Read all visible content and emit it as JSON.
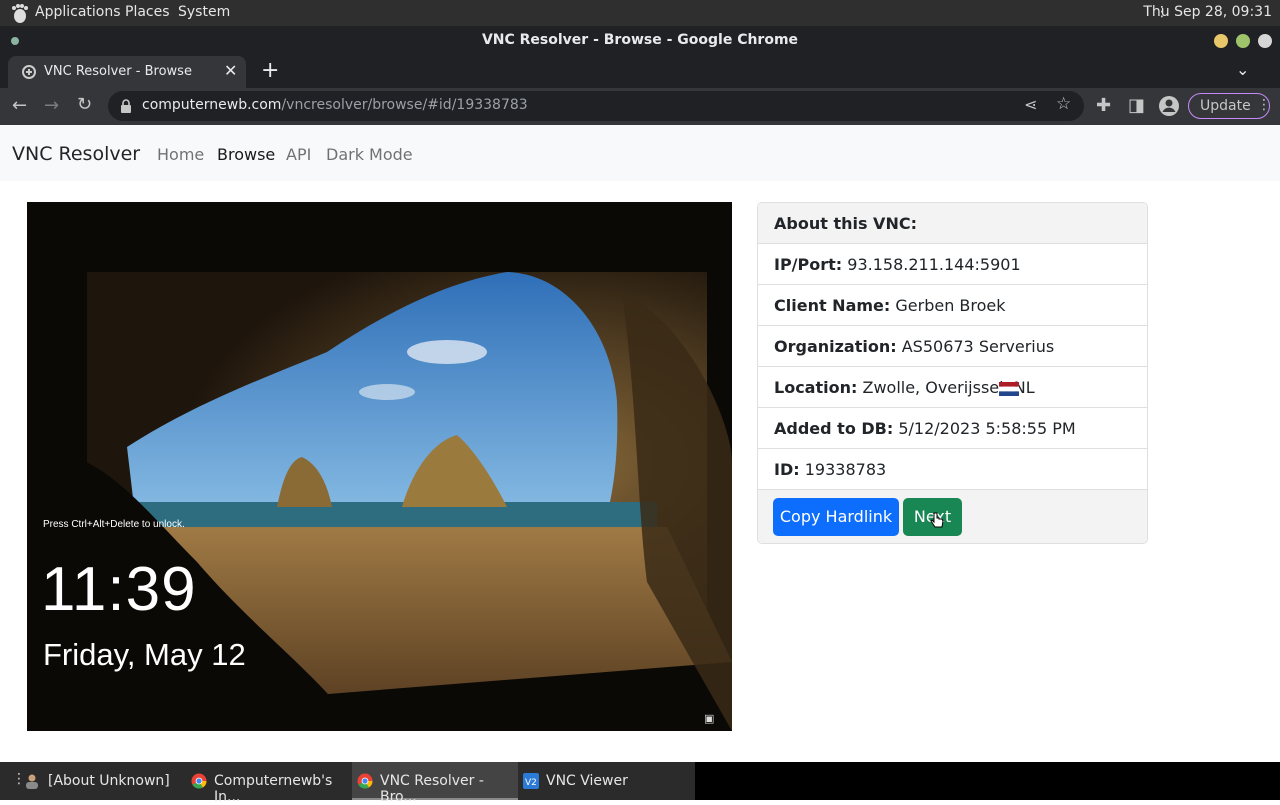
{
  "gnome_panel": {
    "menus": [
      "Applications",
      "Places",
      "System"
    ],
    "clock": "Thu Sep 28, 09:31"
  },
  "window": {
    "title": "VNC Resolver - Browse - Google Chrome"
  },
  "tab": {
    "title": "VNC Resolver - Browse"
  },
  "address_bar": {
    "host": "computernewb.com",
    "path": "/vncresolver/browse/#id/19338783"
  },
  "toolbar": {
    "update_label": "Update"
  },
  "site_nav": {
    "brand": "VNC Resolver",
    "links": [
      "Home",
      "Browse",
      "API",
      "Dark Mode"
    ],
    "active": "Browse"
  },
  "vnc_lockscreen": {
    "hint": "Press Ctrl+Alt+Delete to unlock.",
    "time": "11:39",
    "date": "Friday, May 12"
  },
  "info_card": {
    "header": "About this VNC:",
    "rows": [
      {
        "label": "IP/Port:",
        "value": "93.158.211.144:5901"
      },
      {
        "label": "Client Name:",
        "value": "Gerben Broek"
      },
      {
        "label": "Organization:",
        "value": "AS50673 Serverius"
      },
      {
        "label": "Location:",
        "value": "Zwolle, Overijssel, NL"
      },
      {
        "label": "Added to DB:",
        "value": "5/12/2023 5:58:55 PM"
      },
      {
        "label": "ID:",
        "value": "19338783"
      }
    ],
    "copy_label": "Copy Hardlink",
    "next_label": "Next"
  },
  "taskbar": {
    "items": [
      "[About Unknown]",
      "Computernewb's In...",
      "VNC Resolver - Bro...",
      "VNC Viewer"
    ]
  },
  "colors": {
    "primary_button": "#0d6efd",
    "success_button": "#198754",
    "chrome_dark": "#202124"
  }
}
